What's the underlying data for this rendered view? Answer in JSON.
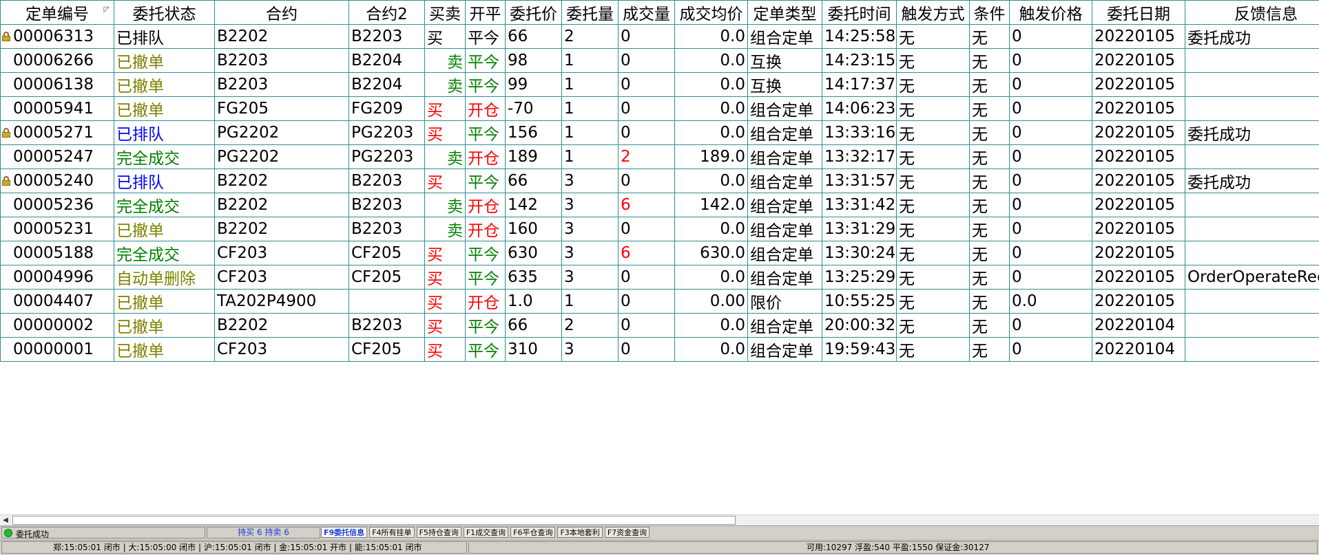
{
  "colors": {
    "grid_line": "#2f8e8e",
    "olive": "#808000",
    "blue": "#0000ff",
    "green": "#008000",
    "red": "#ff0000",
    "black": "#000000",
    "tab_active": "#1a3ee0"
  },
  "columns": [
    "定单编号",
    "委托状态",
    "合约",
    "合约2",
    "买卖",
    "开平",
    "委托价",
    "委托量",
    "成交量",
    "成交均价",
    "定单类型",
    "委托时间",
    "触发方式",
    "条件",
    "触发价格",
    "委托日期",
    "反馈信息"
  ],
  "rows": [
    {
      "locked": true,
      "order_no": "00006313",
      "status": "已排队",
      "status_color": "#000000",
      "contract": "B2202",
      "contract2": "B2203",
      "side": "买",
      "side_color": "#000000",
      "side_align": "left",
      "openclose": "平今",
      "oc_color": "#000000",
      "price": "66",
      "qty": "2",
      "filled": "0",
      "filled_color": "#000000",
      "avg": "0.0",
      "type": "组合定单",
      "time": "14:25:58",
      "trigger": "无",
      "cond": "无",
      "trig_price": "0",
      "date": "20220105",
      "feedback": "委托成功"
    },
    {
      "locked": false,
      "order_no": "00006266",
      "status": "已撤单",
      "status_color": "#808000",
      "contract": "B2203",
      "contract2": "B2204",
      "side": "卖",
      "side_color": "#008000",
      "side_align": "right",
      "openclose": "平今",
      "oc_color": "#008000",
      "price": "98",
      "qty": "1",
      "filled": "0",
      "filled_color": "#000000",
      "avg": "0.0",
      "type": "互换",
      "time": "14:23:15",
      "trigger": "无",
      "cond": "无",
      "trig_price": "0",
      "date": "20220105",
      "feedback": ""
    },
    {
      "locked": false,
      "order_no": "00006138",
      "status": "已撤单",
      "status_color": "#808000",
      "contract": "B2203",
      "contract2": "B2204",
      "side": "卖",
      "side_color": "#008000",
      "side_align": "right",
      "openclose": "平今",
      "oc_color": "#008000",
      "price": "99",
      "qty": "1",
      "filled": "0",
      "filled_color": "#000000",
      "avg": "0.0",
      "type": "互换",
      "time": "14:17:37",
      "trigger": "无",
      "cond": "无",
      "trig_price": "0",
      "date": "20220105",
      "feedback": ""
    },
    {
      "locked": false,
      "order_no": "00005941",
      "status": "已撤单",
      "status_color": "#808000",
      "contract": "FG205",
      "contract2": "FG209",
      "side": "买",
      "side_color": "#ff0000",
      "side_align": "left",
      "openclose": "开仓",
      "oc_color": "#ff0000",
      "price": "-70",
      "qty": "1",
      "filled": "0",
      "filled_color": "#000000",
      "avg": "0.0",
      "type": "组合定单",
      "time": "14:06:23",
      "trigger": "无",
      "cond": "无",
      "trig_price": "0",
      "date": "20220105",
      "feedback": ""
    },
    {
      "locked": true,
      "order_no": "00005271",
      "status": "已排队",
      "status_color": "#0000ff",
      "contract": "PG2202",
      "contract2": "PG2203",
      "side": "买",
      "side_color": "#ff0000",
      "side_align": "left",
      "openclose": "平今",
      "oc_color": "#008000",
      "price": "156",
      "qty": "1",
      "filled": "0",
      "filled_color": "#000000",
      "avg": "0.0",
      "type": "组合定单",
      "time": "13:33:16",
      "trigger": "无",
      "cond": "无",
      "trig_price": "0",
      "date": "20220105",
      "feedback": "委托成功"
    },
    {
      "locked": false,
      "order_no": "00005247",
      "status": "完全成交",
      "status_color": "#008000",
      "contract": "PG2202",
      "contract2": "PG2203",
      "side": "卖",
      "side_color": "#008000",
      "side_align": "right",
      "openclose": "开仓",
      "oc_color": "#ff0000",
      "price": "189",
      "qty": "1",
      "filled": "2",
      "filled_color": "#ff0000",
      "avg": "189.0",
      "type": "组合定单",
      "time": "13:32:17",
      "trigger": "无",
      "cond": "无",
      "trig_price": "0",
      "date": "20220105",
      "feedback": ""
    },
    {
      "locked": true,
      "order_no": "00005240",
      "status": "已排队",
      "status_color": "#0000ff",
      "contract": "B2202",
      "contract2": "B2203",
      "side": "买",
      "side_color": "#ff0000",
      "side_align": "left",
      "openclose": "平今",
      "oc_color": "#008000",
      "price": "66",
      "qty": "3",
      "filled": "0",
      "filled_color": "#000000",
      "avg": "0.0",
      "type": "组合定单",
      "time": "13:31:57",
      "trigger": "无",
      "cond": "无",
      "trig_price": "0",
      "date": "20220105",
      "feedback": "委托成功"
    },
    {
      "locked": false,
      "order_no": "00005236",
      "status": "完全成交",
      "status_color": "#008000",
      "contract": "B2202",
      "contract2": "B2203",
      "side": "卖",
      "side_color": "#008000",
      "side_align": "right",
      "openclose": "开仓",
      "oc_color": "#ff0000",
      "price": "142",
      "qty": "3",
      "filled": "6",
      "filled_color": "#ff0000",
      "avg": "142.0",
      "type": "组合定单",
      "time": "13:31:42",
      "trigger": "无",
      "cond": "无",
      "trig_price": "0",
      "date": "20220105",
      "feedback": ""
    },
    {
      "locked": false,
      "order_no": "00005231",
      "status": "已撤单",
      "status_color": "#808000",
      "contract": "B2202",
      "contract2": "B2203",
      "side": "卖",
      "side_color": "#008000",
      "side_align": "right",
      "openclose": "开仓",
      "oc_color": "#ff0000",
      "price": "160",
      "qty": "3",
      "filled": "0",
      "filled_color": "#000000",
      "avg": "0.0",
      "type": "组合定单",
      "time": "13:31:29",
      "trigger": "无",
      "cond": "无",
      "trig_price": "0",
      "date": "20220105",
      "feedback": ""
    },
    {
      "locked": false,
      "order_no": "00005188",
      "status": "完全成交",
      "status_color": "#008000",
      "contract": "CF203",
      "contract2": "CF205",
      "side": "买",
      "side_color": "#ff0000",
      "side_align": "left",
      "openclose": "平今",
      "oc_color": "#008000",
      "price": "630",
      "qty": "3",
      "filled": "6",
      "filled_color": "#ff0000",
      "avg": "630.0",
      "type": "组合定单",
      "time": "13:30:24",
      "trigger": "无",
      "cond": "无",
      "trig_price": "0",
      "date": "20220105",
      "feedback": ""
    },
    {
      "locked": false,
      "order_no": "00004996",
      "status": "自动单删除",
      "status_color": "#808000",
      "contract": "CF203",
      "contract2": "CF205",
      "side": "买",
      "side_color": "#ff0000",
      "side_align": "left",
      "openclose": "平今",
      "oc_color": "#008000",
      "price": "635",
      "qty": "3",
      "filled": "0",
      "filled_color": "#000000",
      "avg": "0.0",
      "type": "组合定单",
      "time": "13:25:29",
      "trigger": "无",
      "cond": "无",
      "trig_price": "0",
      "date": "20220105",
      "feedback": "OrderOperateRec"
    },
    {
      "locked": false,
      "order_no": "00004407",
      "status": "已撤单",
      "status_color": "#808000",
      "contract": "TA202P4900",
      "contract2": "",
      "side": "买",
      "side_color": "#ff0000",
      "side_align": "left",
      "openclose": "开仓",
      "oc_color": "#ff0000",
      "price": "1.0",
      "qty": "1",
      "filled": "0",
      "filled_color": "#000000",
      "avg": "0.00",
      "type": "限价",
      "time": "10:55:25",
      "trigger": "无",
      "cond": "无",
      "trig_price": "0.0",
      "date": "20220105",
      "feedback": ""
    },
    {
      "locked": false,
      "order_no": "00000002",
      "status": "已撤单",
      "status_color": "#808000",
      "contract": "B2202",
      "contract2": "B2203",
      "side": "买",
      "side_color": "#ff0000",
      "side_align": "left",
      "openclose": "平今",
      "oc_color": "#008000",
      "price": "66",
      "qty": "2",
      "filled": "0",
      "filled_color": "#000000",
      "avg": "0.0",
      "type": "组合定单",
      "time": "20:00:32",
      "trigger": "无",
      "cond": "无",
      "trig_price": "0",
      "date": "20220104",
      "feedback": ""
    },
    {
      "locked": false,
      "order_no": "00000001",
      "status": "已撤单",
      "status_color": "#808000",
      "contract": "CF203",
      "contract2": "CF205",
      "side": "买",
      "side_color": "#ff0000",
      "side_align": "left",
      "openclose": "平今",
      "oc_color": "#008000",
      "price": "310",
      "qty": "3",
      "filled": "0",
      "filled_color": "#000000",
      "avg": "0.0",
      "type": "组合定单",
      "time": "19:59:43",
      "trigger": "无",
      "cond": "无",
      "trig_price": "0",
      "date": "20220104",
      "feedback": ""
    }
  ],
  "tabbar": {
    "status_text": "委托成功",
    "hold_text": "持买 6  持卖 6",
    "tabs": [
      {
        "label": "F9委托信息",
        "active": true
      },
      {
        "label": "F4所有挂单",
        "active": false
      },
      {
        "label": "F5持仓查询",
        "active": false
      },
      {
        "label": "F1成交查询",
        "active": false
      },
      {
        "label": "F6平仓查询",
        "active": false
      },
      {
        "label": "F3本地套利",
        "active": false
      },
      {
        "label": "F7资金查询",
        "active": false
      }
    ]
  },
  "statusbar": {
    "markets": "郑:15:05:01 闭市 | 大:15:05:00 闭市 | 沪:15:05:01 闭市 | 金:15:05:01 开市 | 能:15:05:01 闭市",
    "account": "可用:10297 浮盈:540 平盈:1550 保证金:30127"
  }
}
